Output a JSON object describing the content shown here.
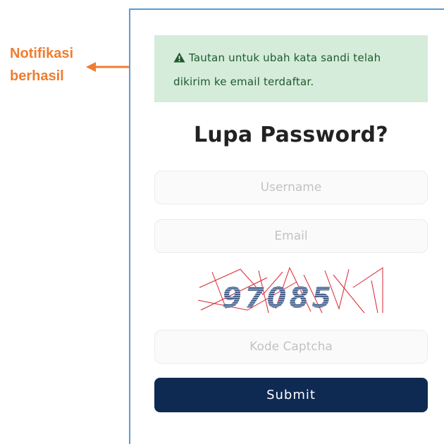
{
  "annotation": {
    "label_line1": "Notifikasi",
    "label_line2": "berhasil",
    "color": "#ee7d31"
  },
  "alert": {
    "icon": "warning-triangle-icon",
    "message": "Tautan untuk ubah kata sandi telah dikirim ke email terdaftar.",
    "background": "#d4ecd9"
  },
  "form": {
    "title": "Lupa Password?",
    "username_placeholder": "Username",
    "email_placeholder": "Email",
    "captcha_text": "97085",
    "captcha_placeholder": "Kode Captcha",
    "submit_label": "Submit",
    "submit_color": "#0f2a52"
  }
}
